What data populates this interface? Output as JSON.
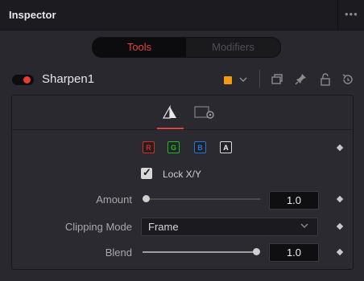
{
  "window": {
    "title": "Inspector",
    "more_glyph": "•••"
  },
  "tabs": [
    {
      "label": "Tools",
      "active": true
    },
    {
      "label": "Modifiers",
      "active": false
    }
  ],
  "node": {
    "name": "Sharpen1",
    "enabled": true,
    "color_swatch": "#f29a11",
    "header_icons": [
      "color-dropdown-icon",
      "versions-icon",
      "pin-icon",
      "lock-icon",
      "reset-icon"
    ]
  },
  "subtabs": [
    {
      "icon": "controls-icon",
      "active": true
    },
    {
      "icon": "settings-icon",
      "active": false
    }
  ],
  "channels": [
    {
      "label": "R",
      "color": "#c93030"
    },
    {
      "label": "G",
      "color": "#2fae3a"
    },
    {
      "label": "B",
      "color": "#2e74c9"
    },
    {
      "label": "A",
      "color": "#dcdcdc"
    }
  ],
  "lock_xy": {
    "label": "Lock X/Y",
    "checked": true
  },
  "amount": {
    "label": "Amount",
    "value": "1.0",
    "slider_fraction": 0.0
  },
  "clipping_mode": {
    "label": "Clipping Mode",
    "value": "Frame"
  },
  "blend": {
    "label": "Blend",
    "value": "1.0",
    "slider_fraction": 1.0
  },
  "colors": {
    "accent": "#e0433c",
    "background": "#28282e"
  }
}
